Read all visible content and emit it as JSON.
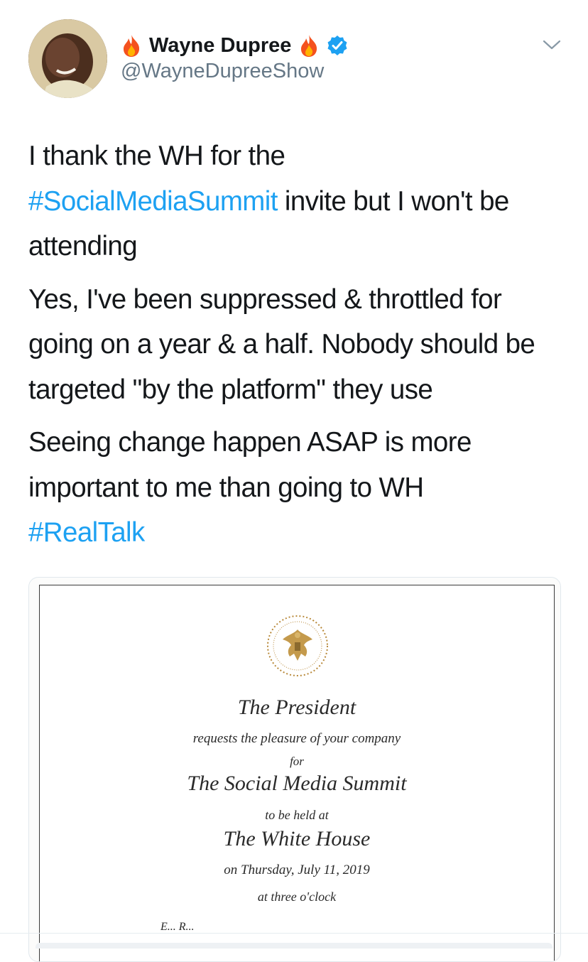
{
  "author": {
    "name": "Wayne Dupree",
    "handle": "@WayneDupreeShow",
    "name_prefix_icon": "fire-emoji",
    "name_suffix_icon": "fire-emoji",
    "verified_icon": "verified-badge",
    "verified_color": "#1da1f2"
  },
  "menu_icon": "chevron-down-icon",
  "tweet": {
    "p1_before": "I thank the WH for the",
    "p1_hashtag": "#SocialMediaSummit",
    "p1_after": " invite but I won't be attending",
    "p2": "Yes, I've been suppressed & throttled for going on a year & a half. Nobody should be targeted \"by the platform\" they use",
    "p3": "Seeing change happen ASAP is more important to me than going to WH",
    "p3_hashtag": "#RealTalk",
    "hashtag_color": "#1da1f2"
  },
  "invitation": {
    "line1": "The President",
    "line2": "requests the pleasure of your company",
    "line3": "for",
    "line4": "The Social Media Summit",
    "line5": "to be held at",
    "line6": "The White House",
    "line7": "on Thursday, July 11, 2019",
    "line8": "at three o'clock",
    "line9": "E... R...",
    "seal_icon": "presidential-seal"
  }
}
